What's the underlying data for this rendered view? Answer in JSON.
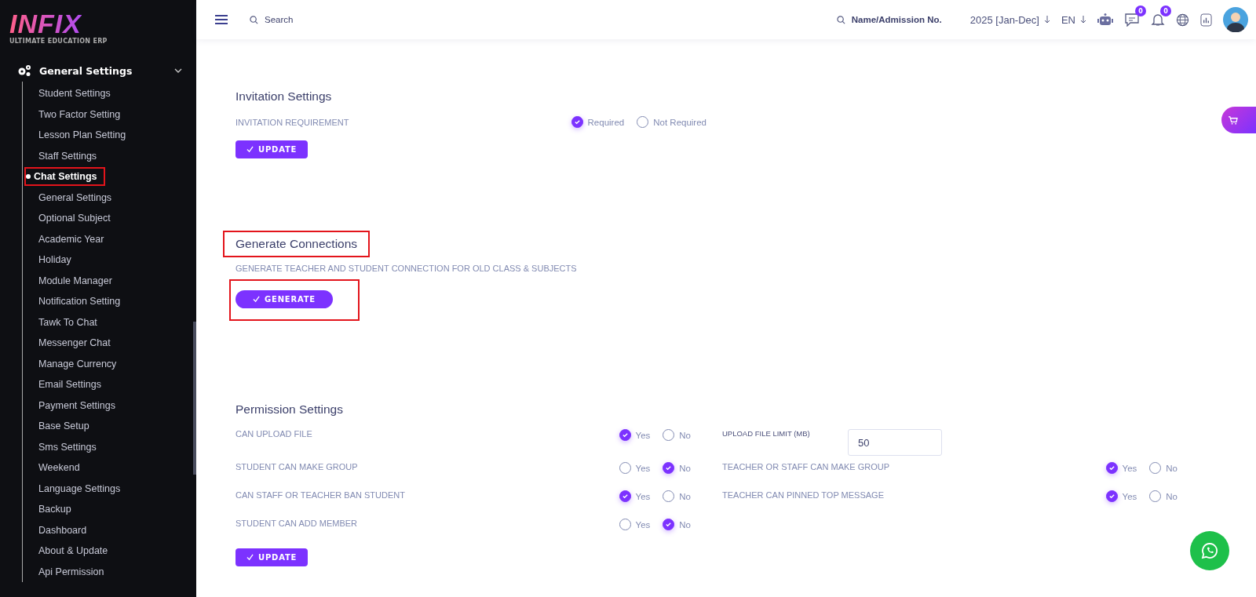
{
  "sidebar": {
    "logo": "INFIX",
    "tagline": "ULTIMATE EDUCATION ERP",
    "group": {
      "label": "General Settings",
      "expanded": true
    },
    "items": [
      {
        "label": "Student Settings",
        "selected": false,
        "annotated": false
      },
      {
        "label": "Two Factor Setting",
        "selected": false,
        "annotated": false
      },
      {
        "label": "Lesson Plan Setting",
        "selected": false,
        "annotated": false
      },
      {
        "label": "Staff Settings",
        "selected": false,
        "annotated": false
      },
      {
        "label": "Chat Settings",
        "selected": true,
        "annotated": true
      },
      {
        "label": "General Settings",
        "selected": false,
        "annotated": false
      },
      {
        "label": "Optional Subject",
        "selected": false,
        "annotated": false
      },
      {
        "label": "Academic Year",
        "selected": false,
        "annotated": false
      },
      {
        "label": "Holiday",
        "selected": false,
        "annotated": false
      },
      {
        "label": "Module Manager",
        "selected": false,
        "annotated": false
      },
      {
        "label": "Notification Setting",
        "selected": false,
        "annotated": false
      },
      {
        "label": "Tawk To Chat",
        "selected": false,
        "annotated": false
      },
      {
        "label": "Messenger Chat",
        "selected": false,
        "annotated": false
      },
      {
        "label": "Manage Currency",
        "selected": false,
        "annotated": false
      },
      {
        "label": "Email Settings",
        "selected": false,
        "annotated": false
      },
      {
        "label": "Payment Settings",
        "selected": false,
        "annotated": false
      },
      {
        "label": "Base Setup",
        "selected": false,
        "annotated": false
      },
      {
        "label": "Sms Settings",
        "selected": false,
        "annotated": false
      },
      {
        "label": "Weekend",
        "selected": false,
        "annotated": false
      },
      {
        "label": "Language Settings",
        "selected": false,
        "annotated": false
      },
      {
        "label": "Backup",
        "selected": false,
        "annotated": false
      },
      {
        "label": "Dashboard",
        "selected": false,
        "annotated": false
      },
      {
        "label": "About & Update",
        "selected": false,
        "annotated": false
      },
      {
        "label": "Api Permission",
        "selected": false,
        "annotated": false
      }
    ]
  },
  "topbar": {
    "search": {
      "placeholder": "Search"
    },
    "student_search": {
      "placeholder": "Name/Admission No."
    },
    "session": "2025 [Jan-Dec]",
    "language": "EN",
    "messages_badge": "0",
    "notifications_badge": "0"
  },
  "invitation": {
    "title": "Invitation Settings",
    "label": "INVITATION REQUIREMENT",
    "options": [
      {
        "label": "Required",
        "selected": true
      },
      {
        "label": "Not Required",
        "selected": false
      }
    ],
    "button": "UPDATE"
  },
  "connections": {
    "title": "Generate Connections",
    "title_annotated": true,
    "description": "GENERATE TEACHER AND STUDENT CONNECTION FOR OLD CLASS & SUBJECTS",
    "button": "GENERATE",
    "button_annotated": true
  },
  "permission": {
    "title": "Permission Settings",
    "rows": [
      {
        "left": {
          "kind": "radio",
          "label": "CAN UPLOAD FILE",
          "options": [
            {
              "label": "Yes",
              "selected": true
            },
            {
              "label": "No",
              "selected": false
            }
          ]
        },
        "right": {
          "kind": "input",
          "label": "UPLOAD FILE LIMIT (MB)",
          "value": "50"
        }
      },
      {
        "left": {
          "kind": "radio",
          "label": "STUDENT CAN MAKE GROUP",
          "options": [
            {
              "label": "Yes",
              "selected": false
            },
            {
              "label": "No",
              "selected": true
            }
          ]
        },
        "right": {
          "kind": "radio",
          "label": "TEACHER OR STAFF CAN MAKE GROUP",
          "options": [
            {
              "label": "Yes",
              "selected": true
            },
            {
              "label": "No",
              "selected": false
            }
          ]
        }
      },
      {
        "left": {
          "kind": "radio",
          "label": "CAN STAFF OR TEACHER BAN STUDENT",
          "options": [
            {
              "label": "Yes",
              "selected": true
            },
            {
              "label": "No",
              "selected": false
            }
          ]
        },
        "right": {
          "kind": "radio",
          "label": "TEACHER CAN PINNED TOP MESSAGE",
          "options": [
            {
              "label": "Yes",
              "selected": true
            },
            {
              "label": "No",
              "selected": false
            }
          ]
        }
      },
      {
        "left": {
          "kind": "radio",
          "label": "STUDENT CAN ADD MEMBER",
          "options": [
            {
              "label": "Yes",
              "selected": false
            },
            {
              "label": "No",
              "selected": true
            }
          ]
        }
      }
    ],
    "button": "UPDATE"
  }
}
